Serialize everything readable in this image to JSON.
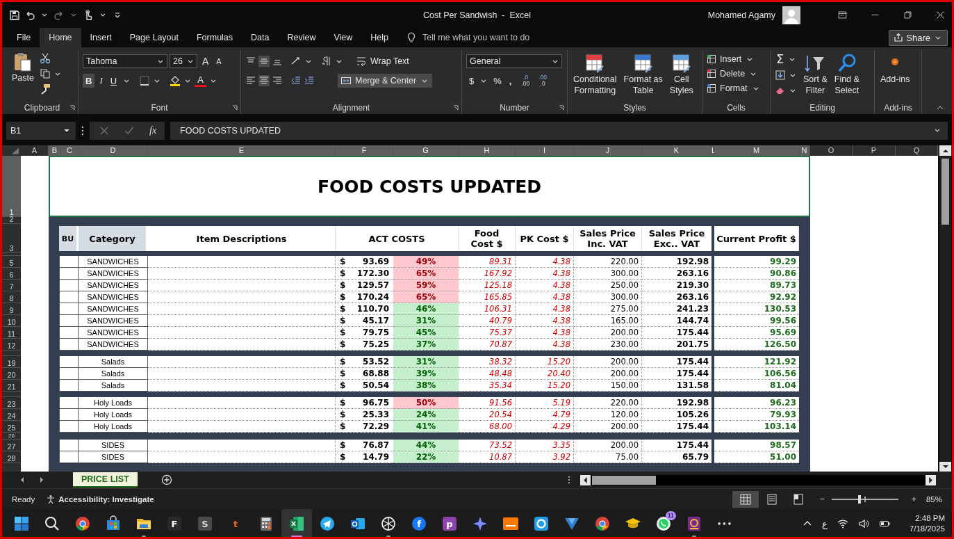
{
  "title_bar": {
    "title": "Cost Per Sandwish  -  Excel",
    "user": "Mohamed Agamy"
  },
  "menu_tabs": [
    {
      "label": "File",
      "selected": false
    },
    {
      "label": "Home",
      "selected": true
    },
    {
      "label": "Insert",
      "selected": false
    },
    {
      "label": "Page Layout",
      "selected": false
    },
    {
      "label": "Formulas",
      "selected": false
    },
    {
      "label": "Data",
      "selected": false
    },
    {
      "label": "Review",
      "selected": false
    },
    {
      "label": "View",
      "selected": false
    },
    {
      "label": "Help",
      "selected": false
    }
  ],
  "tell_me": {
    "placeholder": "Tell me what you want to do"
  },
  "share": {
    "label": "Share"
  },
  "ribbon": {
    "clipboard": {
      "paste": "Paste",
      "group": "Clipboard"
    },
    "font": {
      "family": "Tahoma",
      "size": "26",
      "grow": "A",
      "shrink": "A",
      "bold": "B",
      "italic": "I",
      "underline": "U",
      "color_letter": "A",
      "group": "Font"
    },
    "alignment": {
      "wrap": "Wrap Text",
      "merge": "Merge & Center",
      "group": "Alignment"
    },
    "number": {
      "format": "General",
      "currency": "$",
      "percent": "%",
      "comma": ",",
      "increase_decimal": [
        ".0",
        ".00"
      ],
      "decrease_decimal": [
        ".00",
        ".0"
      ],
      "group": "Number"
    },
    "styles": {
      "buttons": [
        {
          "lines": [
            "Conditional",
            "Formatting"
          ]
        },
        {
          "lines": [
            "Format as",
            "Table"
          ]
        },
        {
          "lines": [
            "Cell",
            "Styles"
          ]
        }
      ],
      "group": "Styles"
    },
    "cells": {
      "buttons": [
        "Insert",
        "Delete",
        "Format"
      ],
      "group": "Cells"
    },
    "editing": {
      "sum": "Σ",
      "buttons": [
        {
          "lines": [
            "Sort &",
            "Filter"
          ]
        },
        {
          "lines": [
            "Find &",
            "Select"
          ]
        }
      ],
      "group": "Editing"
    },
    "addins": {
      "button": "Add-ins",
      "group": "Add-ins"
    }
  },
  "formula_bar": {
    "name_box": "B1",
    "fx": "fx",
    "formula": "FOOD COSTS UPDATED"
  },
  "columns": [
    {
      "letter": "A",
      "selected": false
    },
    {
      "letter": "B",
      "selected": true
    },
    {
      "letter": "C",
      "selected": true
    },
    {
      "letter": "D",
      "selected": true
    },
    {
      "letter": "E",
      "selected": true
    },
    {
      "letter": "F",
      "selected": true
    },
    {
      "letter": "G",
      "selected": true
    },
    {
      "letter": "H",
      "selected": true
    },
    {
      "letter": "I",
      "selected": true
    },
    {
      "letter": "J",
      "selected": true
    },
    {
      "letter": "K",
      "selected": true
    },
    {
      "letter": "L",
      "selected": true
    },
    {
      "letter": "M",
      "selected": true
    },
    {
      "letter": "N",
      "selected": true
    },
    {
      "letter": "O",
      "selected": false
    },
    {
      "letter": "P",
      "selected": false
    },
    {
      "letter": "Q",
      "selected": false
    }
  ],
  "sheet": {
    "title_row": {
      "number": "1",
      "selected": true,
      "text": "FOOD COSTS UPDATED"
    },
    "spacer_row": "2",
    "header_row": "3"
  },
  "price_table": {
    "header": [
      {
        "lines": [
          "BU"
        ]
      },
      {
        "lines": [
          "Category"
        ]
      },
      {
        "lines": [
          "Item Descriptions"
        ]
      },
      {
        "lines": [
          "ACT COSTS"
        ]
      },
      {
        "lines": [
          "Food",
          "Cost $"
        ]
      },
      {
        "lines": [
          "PK Cost $"
        ]
      },
      {
        "lines": [
          "Sales Price",
          "Inc. VAT"
        ]
      },
      {
        "lines": [
          "Sales Price",
          "Exc.. VAT"
        ]
      },
      {
        "lines": [
          "Current Profit $"
        ]
      }
    ],
    "groups": [
      {
        "rows": [
          {
            "row": "5",
            "category": "SANDWICHES",
            "currency": "$",
            "act_cost": "93.69",
            "ratio": "49%",
            "flagged": true,
            "food_cost": "89.31",
            "pk_cost": "4.38",
            "price_inc_vat": "220.00",
            "price_exc_vat": "192.98",
            "profit": "99.29"
          },
          {
            "row": "6",
            "category": "SANDWICHES",
            "currency": "$",
            "act_cost": "172.30",
            "ratio": "65%",
            "flagged": true,
            "food_cost": "167.92",
            "pk_cost": "4.38",
            "price_inc_vat": "300.00",
            "price_exc_vat": "263.16",
            "profit": "90.86"
          },
          {
            "row": "7",
            "category": "SANDWICHES",
            "currency": "$",
            "act_cost": "129.57",
            "ratio": "59%",
            "flagged": true,
            "food_cost": "125.18",
            "pk_cost": "4.38",
            "price_inc_vat": "250.00",
            "price_exc_vat": "219.30",
            "profit": "89.73"
          },
          {
            "row": "8",
            "category": "SANDWICHES",
            "currency": "$",
            "act_cost": "170.24",
            "ratio": "65%",
            "flagged": true,
            "food_cost": "165.85",
            "pk_cost": "4.38",
            "price_inc_vat": "300.00",
            "price_exc_vat": "263.16",
            "profit": "92.92"
          },
          {
            "row": "9",
            "category": "SANDWICHES",
            "currency": "$",
            "act_cost": "110.70",
            "ratio": "46%",
            "flagged": false,
            "food_cost": "106.31",
            "pk_cost": "4.38",
            "price_inc_vat": "275.00",
            "price_exc_vat": "241.23",
            "profit": "130.53"
          },
          {
            "row": "10",
            "category": "SANDWICHES",
            "currency": "$",
            "act_cost": "45.17",
            "ratio": "31%",
            "flagged": false,
            "food_cost": "40.79",
            "pk_cost": "4.38",
            "price_inc_vat": "165.00",
            "price_exc_vat": "144.74",
            "profit": "99.56"
          },
          {
            "row": "11",
            "category": "SANDWICHES",
            "currency": "$",
            "act_cost": "79.75",
            "ratio": "45%",
            "flagged": false,
            "food_cost": "75.37",
            "pk_cost": "4.38",
            "price_inc_vat": "200.00",
            "price_exc_vat": "175.44",
            "profit": "95.69"
          },
          {
            "row": "12",
            "category": "SANDWICHES",
            "currency": "$",
            "act_cost": "75.25",
            "ratio": "37%",
            "flagged": false,
            "food_cost": "70.87",
            "pk_cost": "4.38",
            "price_inc_vat": "230.00",
            "price_exc_vat": "201.75",
            "profit": "126.50"
          }
        ]
      },
      {
        "rows": [
          {
            "row": "19",
            "category": "Salads",
            "currency": "$",
            "act_cost": "53.52",
            "ratio": "31%",
            "flagged": false,
            "food_cost": "38.32",
            "pk_cost": "15.20",
            "price_inc_vat": "200.00",
            "price_exc_vat": "175.44",
            "profit": "121.92"
          },
          {
            "row": "20",
            "category": "Salads",
            "currency": "$",
            "act_cost": "68.88",
            "ratio": "39%",
            "flagged": false,
            "food_cost": "48.48",
            "pk_cost": "20.40",
            "price_inc_vat": "200.00",
            "price_exc_vat": "175.44",
            "profit": "106.56"
          },
          {
            "row": "21",
            "category": "Salads",
            "currency": "$",
            "act_cost": "50.54",
            "ratio": "38%",
            "flagged": false,
            "food_cost": "35.34",
            "pk_cost": "15.20",
            "price_inc_vat": "150.00",
            "price_exc_vat": "131.58",
            "profit": "81.04"
          }
        ]
      },
      {
        "rows": [
          {
            "row": "23",
            "category": "Holy Loads",
            "currency": "$",
            "act_cost": "96.75",
            "ratio": "50%",
            "flagged": true,
            "food_cost": "91.56",
            "pk_cost": "5.19",
            "price_inc_vat": "220.00",
            "price_exc_vat": "192.98",
            "profit": "96.23"
          },
          {
            "row": "24",
            "category": "Holy Loads",
            "currency": "$",
            "act_cost": "25.33",
            "ratio": "24%",
            "flagged": false,
            "food_cost": "20.54",
            "pk_cost": "4.79",
            "price_inc_vat": "120.00",
            "price_exc_vat": "105.26",
            "profit": "79.93"
          },
          {
            "row": "25",
            "category": "Holy Loads",
            "currency": "$",
            "act_cost": "72.29",
            "ratio": "41%",
            "flagged": false,
            "food_cost": "68.00",
            "pk_cost": "4.29",
            "price_inc_vat": "200.00",
            "price_exc_vat": "175.44",
            "profit": "103.14"
          }
        ]
      },
      {
        "separator_row": "26",
        "rows": [
          {
            "row": "27",
            "category": "SIDES",
            "currency": "$",
            "act_cost": "76.87",
            "ratio": "44%",
            "flagged": false,
            "food_cost": "73.52",
            "pk_cost": "3.35",
            "price_inc_vat": "200.00",
            "price_exc_vat": "175.44",
            "profit": "98.57"
          },
          {
            "row": "28",
            "category": "SIDES",
            "currency": "$",
            "act_cost": "14.79",
            "ratio": "22%",
            "flagged": false,
            "food_cost": "10.87",
            "pk_cost": "3.92",
            "price_inc_vat": "75.00",
            "price_exc_vat": "65.79",
            "profit": "51.00"
          }
        ]
      }
    ]
  },
  "sheet_tabs": [
    {
      "label": "PRICE LIST",
      "selected": true
    }
  ],
  "status_bar": {
    "ready": "Ready",
    "accessibility": "Accessibility: Investigate",
    "views": [
      {
        "kind": "normal",
        "selected": true
      },
      {
        "kind": "page_layout",
        "selected": false
      },
      {
        "kind": "page_break",
        "selected": false
      }
    ],
    "zoom_out": "−",
    "zoom_in": "+",
    "zoom": {
      "level": 0.4,
      "label": "85%"
    }
  },
  "taskbar": {
    "apps": [
      {
        "kind": "start",
        "open": false,
        "selected": false
      },
      {
        "kind": "search",
        "open": false,
        "selected": false
      },
      {
        "kind": "chrome",
        "open": false,
        "selected": false
      },
      {
        "kind": "store",
        "open": false,
        "selected": false
      },
      {
        "kind": "folder",
        "open": true,
        "selected": false
      },
      {
        "kind": "letter_dark",
        "glyph": "F",
        "open": false,
        "selected": false
      },
      {
        "kind": "letter_grey",
        "glyph": "S",
        "open": false,
        "selected": false
      },
      {
        "kind": "letter_plain",
        "glyph": "t",
        "open": false,
        "selected": false
      },
      {
        "kind": "calculator",
        "open": false,
        "selected": false
      },
      {
        "kind": "excel",
        "open": true,
        "selected": true
      },
      {
        "kind": "telegram",
        "open": false,
        "selected": false
      },
      {
        "kind": "outlook",
        "open": false,
        "selected": false
      },
      {
        "kind": "knot",
        "open": true,
        "selected": false
      },
      {
        "kind": "letter_round",
        "glyph": "f",
        "open": false,
        "selected": false
      },
      {
        "kind": "letter_purple",
        "glyph": "p",
        "open": false,
        "selected": false
      },
      {
        "kind": "star",
        "open": false,
        "selected": false
      },
      {
        "kind": "orange",
        "open": false,
        "selected": false
      },
      {
        "kind": "ring",
        "open": false,
        "selected": false
      },
      {
        "kind": "vee",
        "open": false,
        "selected": false
      },
      {
        "kind": "chrome",
        "open": false,
        "selected": false
      },
      {
        "kind": "cap",
        "open": false,
        "selected": false
      },
      {
        "kind": "chat",
        "badge": "11",
        "open": false,
        "selected": false
      },
      {
        "kind": "pdf",
        "open": true,
        "selected": false
      },
      {
        "kind": "more",
        "glyph": "•••",
        "open": false,
        "selected": false
      }
    ],
    "language": "ع",
    "time": "2:48 PM",
    "date": "7/18/2025"
  }
}
